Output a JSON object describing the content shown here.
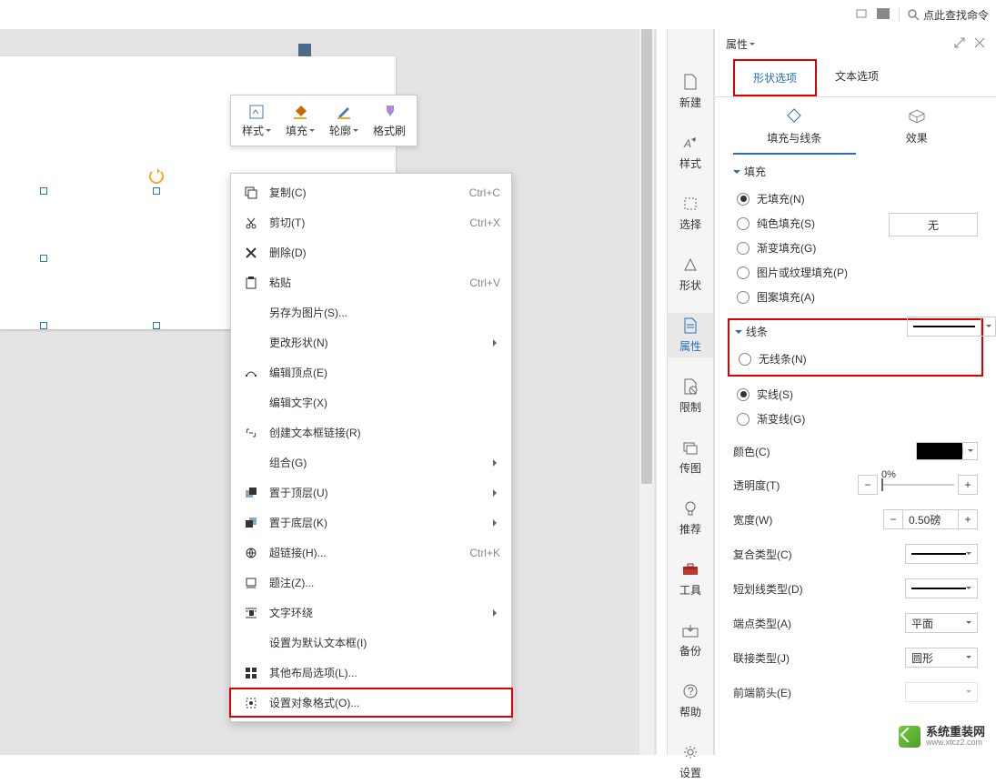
{
  "topbar": {
    "search_placeholder": "点此查找命令"
  },
  "float_toolbar": {
    "style": "样式",
    "fill": "填充",
    "outline": "轮廓",
    "format_painter": "格式刷"
  },
  "context_menu": {
    "copy": "复制(C)",
    "copy_sc": "Ctrl+C",
    "cut": "剪切(T)",
    "cut_sc": "Ctrl+X",
    "delete": "删除(D)",
    "paste": "粘贴",
    "paste_sc": "Ctrl+V",
    "save_as_pic": "另存为图片(S)...",
    "change_shape": "更改形状(N)",
    "edit_points": "编辑顶点(E)",
    "edit_text": "编辑文字(X)",
    "create_link": "创建文本框链接(R)",
    "group": "组合(G)",
    "bring_front": "置于顶层(U)",
    "send_back": "置于底层(K)",
    "hyperlink": "超链接(H)...",
    "hyperlink_sc": "Ctrl+K",
    "caption": "题注(Z)...",
    "wrap": "文字环绕",
    "set_default": "设置为默认文本框(I)",
    "layout_opts": "其他布局选项(L)...",
    "format_obj": "设置对象格式(O)..."
  },
  "rail": {
    "new": "新建",
    "style": "样式",
    "select": "选择",
    "shape": "形状",
    "props": "属性",
    "limit": "限制",
    "image": "传图",
    "recommend": "推荐",
    "tools": "工具",
    "backup": "备份",
    "help": "帮助",
    "settings": "设置"
  },
  "panel": {
    "title": "属性",
    "tab_shape": "形状选项",
    "tab_text": "文本选项",
    "subtab_fill": "填充与线条",
    "subtab_effect": "效果",
    "fill_section": "填充",
    "fill_none_btn": "无",
    "fill_none": "无填充(N)",
    "fill_solid": "纯色填充(S)",
    "fill_gradient": "渐变填充(G)",
    "fill_picture": "图片或纹理填充(P)",
    "fill_pattern": "图案填充(A)",
    "line_section": "线条",
    "line_none": "无线条(N)",
    "line_solid": "实线(S)",
    "line_gradient": "渐变线(G)",
    "color": "颜色(C)",
    "transparency": "透明度(T)",
    "transparency_val": "0%",
    "width": "宽度(W)",
    "width_val": "0.50磅",
    "compound": "复合类型(C)",
    "dash": "短划线类型(D)",
    "cap": "端点类型(A)",
    "cap_val": "平面",
    "join": "联接类型(J)",
    "join_val": "圆形",
    "arrow_begin": "前端箭头(E)"
  },
  "watermark": {
    "main": "系统重装网",
    "sub": "www.xtcz2.com"
  }
}
